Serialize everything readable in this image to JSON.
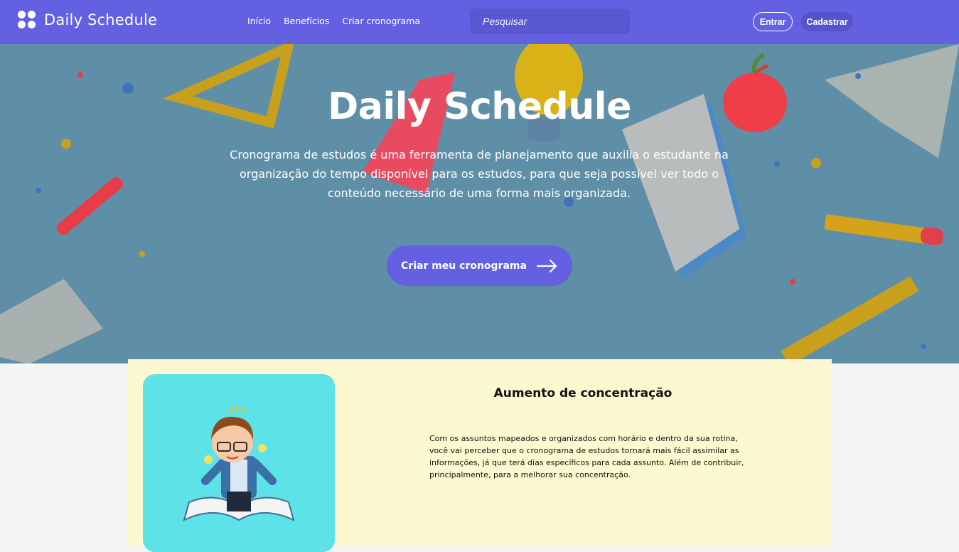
{
  "nav": {
    "logo_text": "Daily Schedule",
    "links": [
      "Início",
      "Benefícios",
      "Criar cronograma"
    ],
    "search_placeholder": "Pesquisar",
    "login_label": "Entrar",
    "signup_label": "Cadastrar"
  },
  "hero": {
    "title": "Daily Schedule",
    "description": "Cronograma de estudos é uma ferramenta de planejamento que auxilia o estudante na organização do tempo disponível para os estudos, para que seja possível ver todo o conteúdo necessário de uma forma mais organizada.",
    "cta_label": "Criar meu cronograma",
    "cta_icon": "arrow-right-icon"
  },
  "benefit": {
    "title": "Aumento de concentração",
    "text": "Com os assuntos mapeados e organizados com horário e dentro da sua rotina, você vai perceber que o cronograma de estudos tornará mais fácil assimilar as informações, já que terá dias específicos para cada assunto. Além de contribuir, principalmente, para a melhorar sua concentração.",
    "image": "student-reading-book-illustration"
  },
  "colors": {
    "primary": "#6460e2",
    "hero_overlay": "#5f8fa7",
    "card_bg": "#fdf8cf",
    "image_bg": "#5de2e7"
  }
}
